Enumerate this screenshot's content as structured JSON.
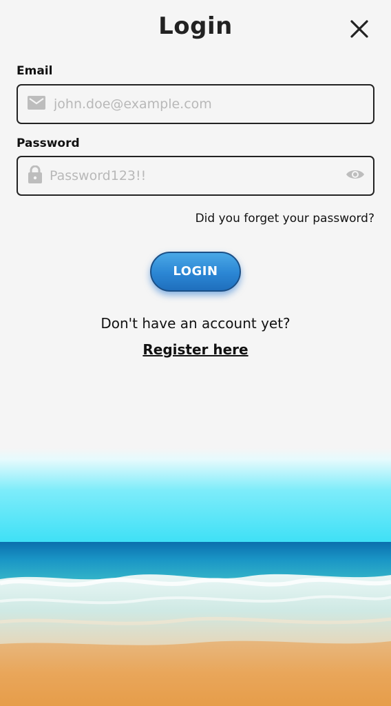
{
  "header": {
    "title": "Login",
    "close_icon": "close-icon"
  },
  "form": {
    "email": {
      "label": "Email",
      "placeholder": "john.doe@example.com",
      "icon": "mail-icon"
    },
    "password": {
      "label": "Password",
      "placeholder": "Password123!!",
      "icon": "lock-icon",
      "toggle_icon": "eye-icon"
    },
    "forgot_password": "Did you forget your password?",
    "login_button": "LOGIN"
  },
  "footer": {
    "no_account_text": "Don't have an account yet?",
    "register_link": "Register here"
  },
  "colors": {
    "background": "#f5f5f5",
    "button_blue": "#2b86d4",
    "sky": "#43e1f7",
    "sea": "#1e9bc4",
    "sand": "#e9a85a"
  }
}
